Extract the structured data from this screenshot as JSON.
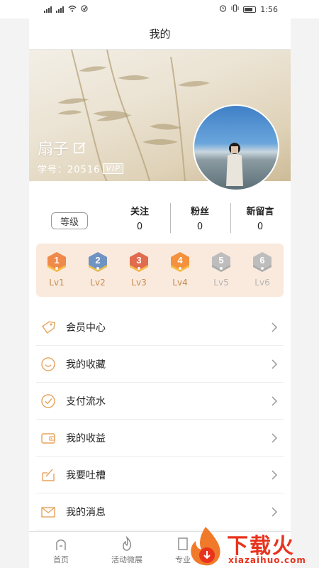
{
  "status_bar": {
    "time": "1:56"
  },
  "nav": {
    "title": "我的"
  },
  "profile": {
    "name": "扇子",
    "student_id": "学号：20516",
    "vip": "VIP"
  },
  "stats": {
    "grade_label": "等级",
    "items": [
      {
        "label": "关注",
        "value": "0"
      },
      {
        "label": "粉丝",
        "value": "0"
      },
      {
        "label": "新留言",
        "value": "0"
      }
    ]
  },
  "levels": [
    {
      "num": "1",
      "label": "Lv1",
      "color": "#f08a4b",
      "active": true
    },
    {
      "num": "2",
      "label": "Lv2",
      "color": "#6f93c2",
      "active": true
    },
    {
      "num": "3",
      "label": "Lv3",
      "color": "#e06b4f",
      "active": true
    },
    {
      "num": "4",
      "label": "Lv4",
      "color": "#f3913d",
      "active": true
    },
    {
      "num": "5",
      "label": "Lv5",
      "color": "#bdbdbd",
      "active": false
    },
    {
      "num": "6",
      "label": "Lv6",
      "color": "#bdbdbd",
      "active": false
    }
  ],
  "menu": [
    {
      "label": "会员中心",
      "icon": "tag-icon"
    },
    {
      "label": "我的收藏",
      "icon": "smile-icon"
    },
    {
      "label": "支付流水",
      "icon": "check-circle-icon"
    },
    {
      "label": "我的收益",
      "icon": "wallet-icon"
    },
    {
      "label": "我要吐槽",
      "icon": "chat-edit-icon"
    },
    {
      "label": "我的消息",
      "icon": "mail-icon"
    }
  ],
  "tabbar": [
    {
      "label": "首页",
      "icon": "home-icon"
    },
    {
      "label": "活动微展",
      "icon": "flame-icon"
    },
    {
      "label": "专业",
      "icon": "book-icon"
    }
  ],
  "watermark": {
    "text": "下载火",
    "sub": "xiazaihuo.com"
  },
  "colors": {
    "accent": "#e8a35c",
    "level_bg": "#faeade",
    "watermark": "#e8331d"
  }
}
